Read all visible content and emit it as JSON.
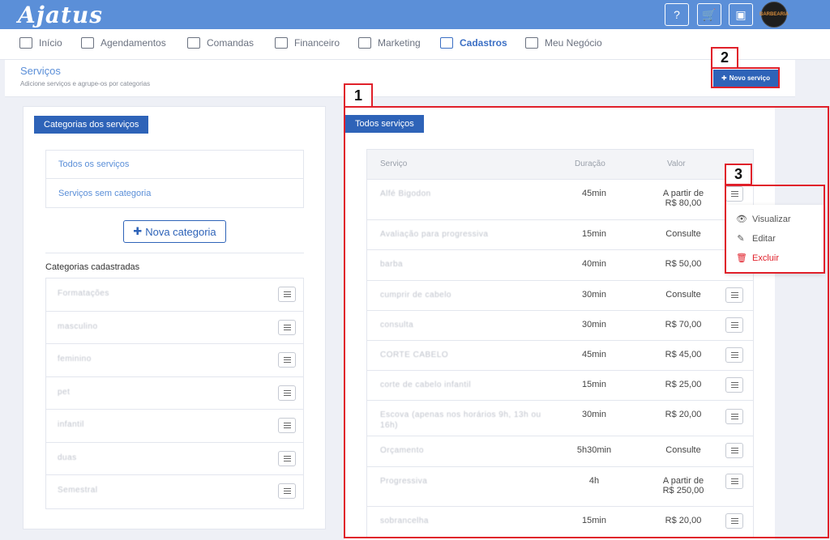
{
  "app": {
    "logo": "Ajatus"
  },
  "topbar": {
    "help_icon_label": "?",
    "cart_icon_label": "🛒",
    "calendar_icon_label": "▣",
    "avatar_text": "BARBEARIA"
  },
  "nav": [
    {
      "label": "Início",
      "icon": "home-icon",
      "active": false
    },
    {
      "label": "Agendamentos",
      "icon": "calendar-check-icon",
      "active": false
    },
    {
      "label": "Comandas",
      "icon": "cart-icon",
      "active": false
    },
    {
      "label": "Financeiro",
      "icon": "money-icon",
      "active": false
    },
    {
      "label": "Marketing",
      "icon": "megaphone-icon",
      "active": false
    },
    {
      "label": "Cadastros",
      "icon": "id-card-icon",
      "active": true
    },
    {
      "label": "Meu Negócio",
      "icon": "store-icon",
      "active": false
    }
  ],
  "header": {
    "title": "Serviços",
    "subtitle": "Adicione serviços e agrupe-os por categorias",
    "new_service_label": "Novo serviço"
  },
  "annotations": [
    "1",
    "2",
    "3"
  ],
  "categories_panel": {
    "tab_label": "Categorias dos serviços",
    "filters": [
      "Todos os serviços",
      "Serviços sem categoria"
    ],
    "new_category_label": "Nova categoria",
    "registered_title": "Categorias cadastradas",
    "registered": [
      "Formatações",
      "masculino",
      "feminino",
      "pet",
      "infantil",
      "duas",
      "Semestral"
    ]
  },
  "services_panel": {
    "tab_label": "Todos serviços",
    "columns": {
      "service": "Serviço",
      "duration": "Duração",
      "value": "Valor"
    },
    "rows": [
      {
        "name": "Alfé Bigodon",
        "duration": "45min",
        "value_line1": "A partir de",
        "value_line2": "R$ 80,00"
      },
      {
        "name": "Avaliação para progressiva",
        "duration": "15min",
        "value_line1": "Consulte",
        "value_line2": ""
      },
      {
        "name": "barba",
        "duration": "40min",
        "value_line1": "R$ 50,00",
        "value_line2": ""
      },
      {
        "name": "cumprir de cabelo",
        "duration": "30min",
        "value_line1": "Consulte",
        "value_line2": ""
      },
      {
        "name": "consulta",
        "duration": "30min",
        "value_line1": "R$ 70,00",
        "value_line2": ""
      },
      {
        "name": "CORTE CABELO",
        "duration": "45min",
        "value_line1": "R$ 45,00",
        "value_line2": ""
      },
      {
        "name": "corte de cabelo infantil",
        "duration": "15min",
        "value_line1": "R$ 25,00",
        "value_line2": ""
      },
      {
        "name": "Escova (apenas nos horários 9h, 13h ou 16h)",
        "duration": "30min",
        "value_line1": "R$ 20,00",
        "value_line2": ""
      },
      {
        "name": "Orçamento",
        "duration": "5h30min",
        "value_line1": "Consulte",
        "value_line2": ""
      },
      {
        "name": "Progressiva",
        "duration": "4h",
        "value_line1": "A partir de",
        "value_line2": "R$ 250,00"
      },
      {
        "name": "sobrancelha",
        "duration": "15min",
        "value_line1": "R$ 20,00",
        "value_line2": ""
      }
    ]
  },
  "row_menu": {
    "view_label": "Visualizar",
    "edit_label": "Editar",
    "delete_label": "Excluir"
  },
  "colors": {
    "brand": "#5b8fd8",
    "primary_button": "#2e63b8",
    "annotation": "#e0202a"
  }
}
